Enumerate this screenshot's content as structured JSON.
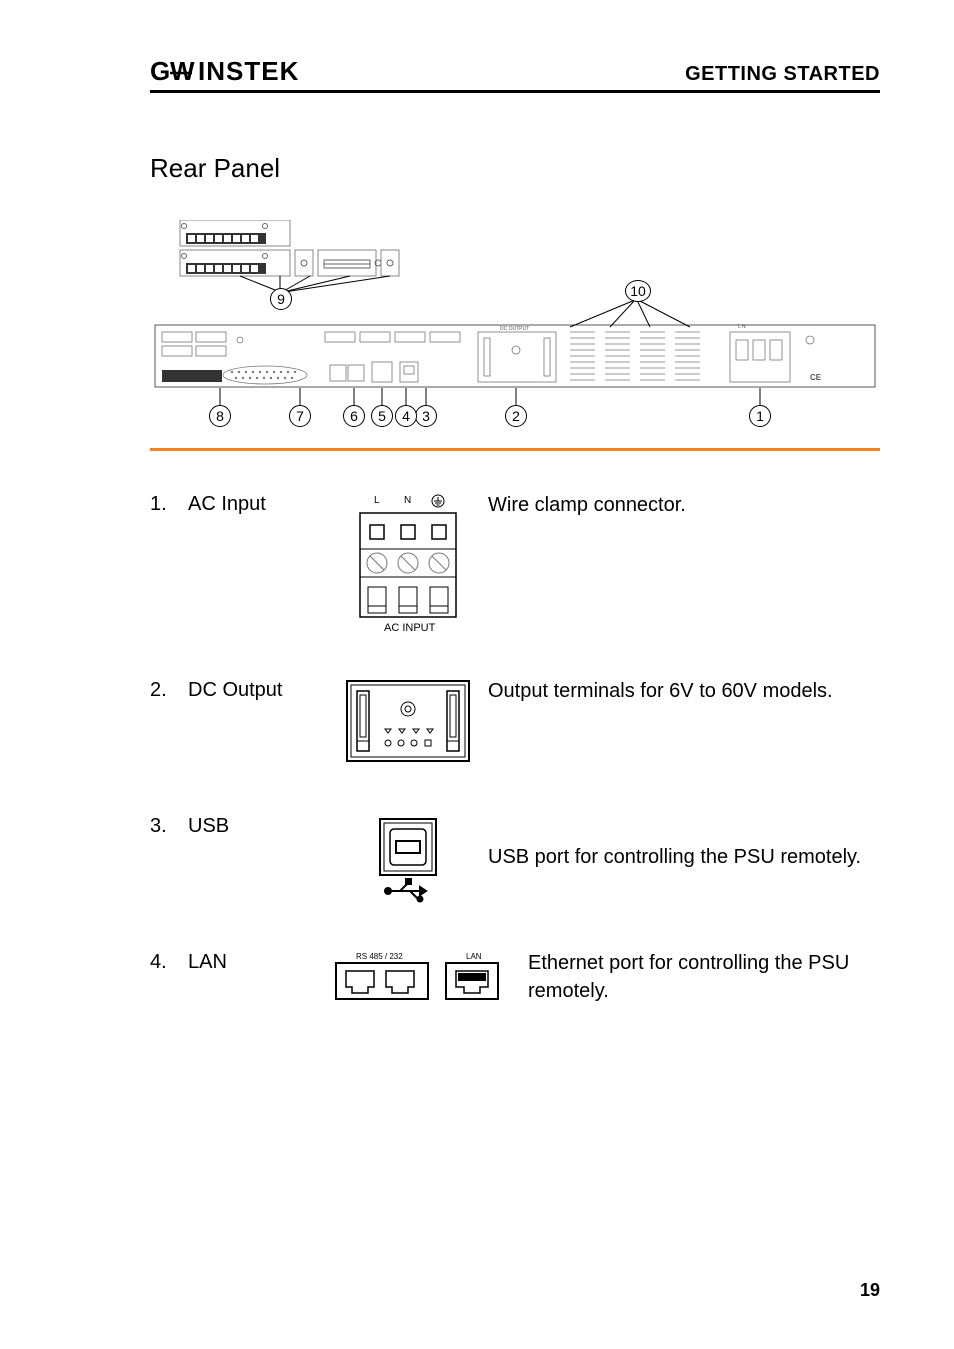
{
  "header": {
    "logo_text": "GWINSTEK",
    "right": "GETTING STARTED"
  },
  "section_title": "Rear Panel",
  "callouts": [
    "1",
    "2",
    "3",
    "4",
    "5",
    "6",
    "7",
    "8",
    "9",
    "10"
  ],
  "items": [
    {
      "num": "1.",
      "label": "AC Input",
      "desc": "Wire clamp connector.",
      "icon_caption": "AC INPUT",
      "icon_terminals": [
        "L",
        "N",
        "⏚"
      ]
    },
    {
      "num": "2.",
      "label": "DC Output",
      "desc": "Output terminals for 6V to 60V models."
    },
    {
      "num": "3.",
      "label": "USB",
      "desc": "USB port for controlling the PSU remotely."
    },
    {
      "num": "4.",
      "label": "LAN",
      "desc": "Ethernet port for controlling the PSU remotely.",
      "icon_labels": [
        "RS 485 / 232",
        "LAN"
      ]
    }
  ],
  "page_number": "19"
}
